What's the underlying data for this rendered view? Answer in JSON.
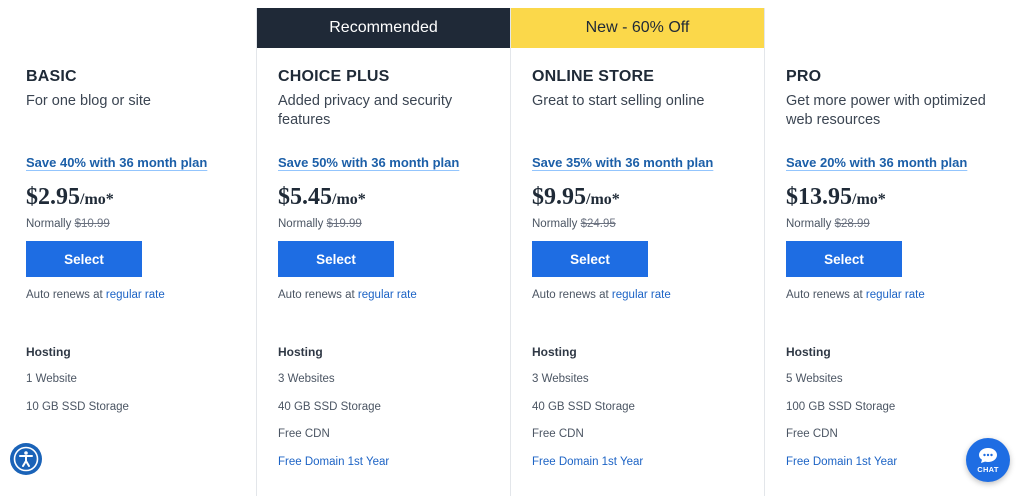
{
  "plans": [
    {
      "banner": "",
      "name": "BASIC",
      "description": "For one blog or site",
      "save_text": "Save 40% with 36 month plan",
      "price": "$2.95",
      "per": "/mo*",
      "normally_label": "Normally",
      "normally_price": "$10.99",
      "select_label": "Select",
      "auto_renew_text": "Auto renews at",
      "auto_renew_link": "regular rate",
      "features_heading": "Hosting",
      "features": [
        "1 Website",
        "10 GB SSD Storage"
      ],
      "feature_link": ""
    },
    {
      "banner": "Recommended",
      "name": "CHOICE PLUS",
      "description": "Added privacy and security features",
      "save_text": "Save 50% with 36 month plan",
      "price": "$5.45",
      "per": "/mo*",
      "normally_label": "Normally",
      "normally_price": "$19.99",
      "select_label": "Select",
      "auto_renew_text": "Auto renews at",
      "auto_renew_link": "regular rate",
      "features_heading": "Hosting",
      "features": [
        "3 Websites",
        "40 GB SSD Storage",
        "Free CDN"
      ],
      "feature_link": "Free Domain 1st Year"
    },
    {
      "banner": "New - 60% Off",
      "name": "ONLINE STORE",
      "description": "Great to start selling online",
      "save_text": "Save 35% with 36 month plan",
      "price": "$9.95",
      "per": "/mo*",
      "normally_label": "Normally",
      "normally_price": "$24.95",
      "select_label": "Select",
      "auto_renew_text": "Auto renews at",
      "auto_renew_link": "regular rate",
      "features_heading": "Hosting",
      "features": [
        "3 Websites",
        "40 GB SSD Storage",
        "Free CDN"
      ],
      "feature_link": "Free Domain 1st Year"
    },
    {
      "banner": "",
      "name": "PRO",
      "description": "Get more power with optimized web resources",
      "save_text": "Save 20% with 36 month plan",
      "price": "$13.95",
      "per": "/mo*",
      "normally_label": "Normally",
      "normally_price": "$28.99",
      "select_label": "Select",
      "auto_renew_text": "Auto renews at",
      "auto_renew_link": "regular rate",
      "features_heading": "Hosting",
      "features": [
        "5 Websites",
        "100 GB SSD Storage",
        "Free CDN"
      ],
      "feature_link": "Free Domain 1st Year"
    }
  ],
  "chat": {
    "label": "CHAT",
    "icon": "chat-bubble-icon"
  },
  "accessibility": {
    "icon": "accessibility-icon"
  },
  "colors": {
    "accent": "#1e6de3",
    "banner_dark": "#1f2937",
    "banner_yellow": "#fbd84a",
    "link": "#1c63c5"
  }
}
